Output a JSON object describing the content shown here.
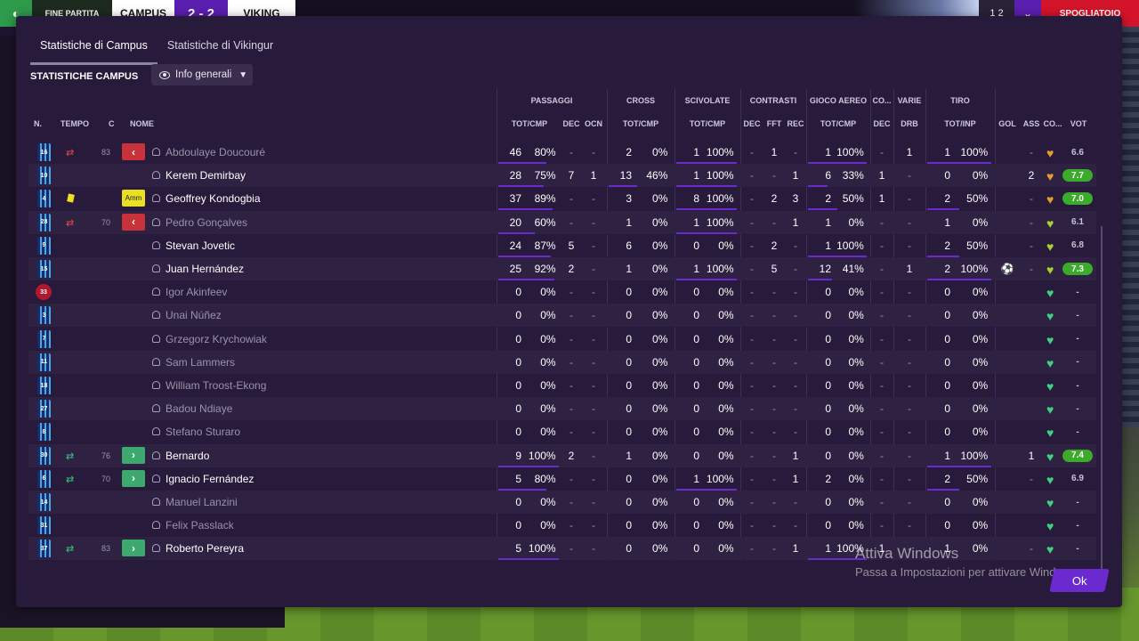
{
  "topbar": {
    "status": "FINE PARTITA",
    "home_team": "CAMPUS",
    "score": "2 - 2",
    "away_team": "VIKING",
    "right_count": "1 2",
    "right_label": "SPOGLIATOIO"
  },
  "tabs": [
    "Statistiche di Campus",
    "Statistiche di Vikingur"
  ],
  "section_title": "STATISTICHE CAMPUS",
  "view_select": "Info generali",
  "group_headers": [
    "PASSAGGI",
    "CROSS",
    "SCIVOLATE",
    "CONTRASTI",
    "GIOCO AEREO",
    "CO...",
    "VARIE",
    "TIRO"
  ],
  "column_headers": {
    "n": "N.",
    "tempo": "TEMPO",
    "c": "C",
    "nome": "NOME",
    "pass": "TOT/CMP",
    "dec": "DEC",
    "ocn": "OCN",
    "cross": "TOT/CMP",
    "sciv": "TOT/CMP",
    "cdec": "DEC",
    "fft": "FFT",
    "rec": "REC",
    "aereo": "TOT/CMP",
    "codec": "DEC",
    "drb": "DRB",
    "tiro": "TOT/INP",
    "gol": "GOL",
    "ass": "ASS",
    "co": "CO...",
    "vot": "VOT"
  },
  "players": [
    {
      "num": "16",
      "sub": "out",
      "min": "83",
      "badge": "out",
      "name": "Abdoulaye Doucouré",
      "dim": true,
      "p_tot": "46",
      "p_pct": "80%",
      "p_bar": 80,
      "dec": "-",
      "ocn": "-",
      "c_tot": "2",
      "c_pct": "0%",
      "s_tot": "1",
      "s_pct": "100%",
      "cdec": "-",
      "fft": "1",
      "rec": "-",
      "a_tot": "1",
      "a_pct": "100%",
      "codec": "-",
      "drb": "1",
      "t_tot": "1",
      "t_pct": "100%",
      "gol": "",
      "ass": "-",
      "heart": "#e0a030",
      "vote": "6.6",
      "vote_hi": false
    },
    {
      "num": "10",
      "sub": "",
      "min": "",
      "badge": "",
      "name": "Kerem Demirbay",
      "dim": false,
      "p_tot": "28",
      "p_pct": "75%",
      "p_bar": 75,
      "dec": "7",
      "ocn": "1",
      "c_tot": "13",
      "c_pct": "46%",
      "s_tot": "1",
      "s_pct": "100%",
      "cdec": "-",
      "fft": "-",
      "rec": "1",
      "a_tot": "6",
      "a_pct": "33%",
      "codec": "1",
      "drb": "-",
      "t_tot": "0",
      "t_pct": "0%",
      "gol": "",
      "ass": "2",
      "heart": "#e0a030",
      "vote": "7.7",
      "vote_hi": true
    },
    {
      "num": "4",
      "sub": "",
      "min": "",
      "badge": "amm",
      "yellow": true,
      "name": "Geoffrey Kondogbia",
      "dim": false,
      "p_tot": "37",
      "p_pct": "89%",
      "p_bar": 89,
      "dec": "-",
      "ocn": "-",
      "c_tot": "3",
      "c_pct": "0%",
      "s_tot": "8",
      "s_pct": "100%",
      "cdec": "-",
      "fft": "2",
      "rec": "3",
      "a_tot": "2",
      "a_pct": "50%",
      "codec": "1",
      "drb": "-",
      "t_tot": "2",
      "t_pct": "50%",
      "gol": "",
      "ass": "-",
      "heart": "#e0a030",
      "vote": "7.0",
      "vote_hi": true
    },
    {
      "num": "28",
      "sub": "out",
      "min": "70",
      "badge": "out",
      "name": "Pedro Gonçalves",
      "dim": true,
      "p_tot": "20",
      "p_pct": "60%",
      "p_bar": 60,
      "dec": "-",
      "ocn": "-",
      "c_tot": "1",
      "c_pct": "0%",
      "s_tot": "1",
      "s_pct": "100%",
      "cdec": "-",
      "fft": "-",
      "rec": "1",
      "a_tot": "1",
      "a_pct": "0%",
      "codec": "-",
      "drb": "-",
      "t_tot": "1",
      "t_pct": "0%",
      "gol": "",
      "ass": "-",
      "heart": "#a8d030",
      "vote": "6.1",
      "vote_hi": false
    },
    {
      "num": "9",
      "sub": "",
      "min": "",
      "badge": "",
      "name": "Stevan Jovetic",
      "dim": false,
      "p_tot": "24",
      "p_pct": "87%",
      "p_bar": 87,
      "dec": "5",
      "ocn": "-",
      "c_tot": "6",
      "c_pct": "0%",
      "s_tot": "0",
      "s_pct": "0%",
      "cdec": "-",
      "fft": "2",
      "rec": "-",
      "a_tot": "1",
      "a_pct": "100%",
      "codec": "-",
      "drb": "-",
      "t_tot": "2",
      "t_pct": "50%",
      "gol": "",
      "ass": "-",
      "heart": "#a8d030",
      "vote": "6.8",
      "vote_hi": false
    },
    {
      "num": "15",
      "sub": "",
      "min": "",
      "badge": "",
      "name": "Juan Hernández",
      "dim": false,
      "p_tot": "25",
      "p_pct": "92%",
      "p_bar": 92,
      "dec": "2",
      "ocn": "-",
      "c_tot": "1",
      "c_pct": "0%",
      "s_tot": "1",
      "s_pct": "100%",
      "cdec": "-",
      "fft": "5",
      "rec": "-",
      "a_tot": "12",
      "a_pct": "41%",
      "codec": "-",
      "drb": "1",
      "t_tot": "2",
      "t_pct": "100%",
      "gol": "⚽",
      "ass": "-",
      "heart": "#a8d030",
      "vote": "7.3",
      "vote_hi": true
    },
    {
      "num": "33",
      "gk": true,
      "sub": "",
      "min": "",
      "badge": "",
      "name": "Igor Akinfeev",
      "dim": true,
      "p_tot": "0",
      "p_pct": "0%",
      "p_bar": 0,
      "dec": "-",
      "ocn": "-",
      "c_tot": "0",
      "c_pct": "0%",
      "s_tot": "0",
      "s_pct": "0%",
      "cdec": "-",
      "fft": "-",
      "rec": "-",
      "a_tot": "0",
      "a_pct": "0%",
      "codec": "-",
      "drb": "-",
      "t_tot": "0",
      "t_pct": "0%",
      "gol": "",
      "ass": "",
      "heart": "#3fd080",
      "vote": "-",
      "vote_hi": false
    },
    {
      "num": "3",
      "sub": "",
      "min": "",
      "badge": "",
      "name": "Unai Núñez",
      "dim": true,
      "p_tot": "0",
      "p_pct": "0%",
      "p_bar": 0,
      "dec": "-",
      "ocn": "-",
      "c_tot": "0",
      "c_pct": "0%",
      "s_tot": "0",
      "s_pct": "0%",
      "cdec": "-",
      "fft": "-",
      "rec": "-",
      "a_tot": "0",
      "a_pct": "0%",
      "codec": "-",
      "drb": "-",
      "t_tot": "0",
      "t_pct": "0%",
      "gol": "",
      "ass": "",
      "heart": "#3fd080",
      "vote": "-",
      "vote_hi": false
    },
    {
      "num": "7",
      "sub": "",
      "min": "",
      "badge": "",
      "name": "Grzegorz Krychowiak",
      "dim": true,
      "p_tot": "0",
      "p_pct": "0%",
      "p_bar": 0,
      "dec": "-",
      "ocn": "-",
      "c_tot": "0",
      "c_pct": "0%",
      "s_tot": "0",
      "s_pct": "0%",
      "cdec": "-",
      "fft": "-",
      "rec": "-",
      "a_tot": "0",
      "a_pct": "0%",
      "codec": "-",
      "drb": "-",
      "t_tot": "0",
      "t_pct": "0%",
      "gol": "",
      "ass": "",
      "heart": "#3fd080",
      "vote": "-",
      "vote_hi": false
    },
    {
      "num": "11",
      "sub": "",
      "min": "",
      "badge": "",
      "name": "Sam Lammers",
      "dim": true,
      "p_tot": "0",
      "p_pct": "0%",
      "p_bar": 0,
      "dec": "-",
      "ocn": "-",
      "c_tot": "0",
      "c_pct": "0%",
      "s_tot": "0",
      "s_pct": "0%",
      "cdec": "-",
      "fft": "-",
      "rec": "-",
      "a_tot": "0",
      "a_pct": "0%",
      "codec": "-",
      "drb": "-",
      "t_tot": "0",
      "t_pct": "0%",
      "gol": "",
      "ass": "",
      "heart": "#3fd080",
      "vote": "-",
      "vote_hi": false
    },
    {
      "num": "18",
      "sub": "",
      "min": "",
      "badge": "",
      "name": "William Troost-Ekong",
      "dim": true,
      "p_tot": "0",
      "p_pct": "0%",
      "p_bar": 0,
      "dec": "-",
      "ocn": "-",
      "c_tot": "0",
      "c_pct": "0%",
      "s_tot": "0",
      "s_pct": "0%",
      "cdec": "-",
      "fft": "-",
      "rec": "-",
      "a_tot": "0",
      "a_pct": "0%",
      "codec": "-",
      "drb": "-",
      "t_tot": "0",
      "t_pct": "0%",
      "gol": "",
      "ass": "",
      "heart": "#3fd080",
      "vote": "-",
      "vote_hi": false
    },
    {
      "num": "27",
      "sub": "",
      "min": "",
      "badge": "",
      "name": "Badou Ndiaye",
      "dim": true,
      "p_tot": "0",
      "p_pct": "0%",
      "p_bar": 0,
      "dec": "-",
      "ocn": "-",
      "c_tot": "0",
      "c_pct": "0%",
      "s_tot": "0",
      "s_pct": "0%",
      "cdec": "-",
      "fft": "-",
      "rec": "-",
      "a_tot": "0",
      "a_pct": "0%",
      "codec": "-",
      "drb": "-",
      "t_tot": "0",
      "t_pct": "0%",
      "gol": "",
      "ass": "",
      "heart": "#3fd080",
      "vote": "-",
      "vote_hi": false
    },
    {
      "num": "8",
      "sub": "",
      "min": "",
      "badge": "",
      "name": "Stefano Sturaro",
      "dim": true,
      "p_tot": "0",
      "p_pct": "0%",
      "p_bar": 0,
      "dec": "-",
      "ocn": "-",
      "c_tot": "0",
      "c_pct": "0%",
      "s_tot": "0",
      "s_pct": "0%",
      "cdec": "-",
      "fft": "-",
      "rec": "-",
      "a_tot": "0",
      "a_pct": "0%",
      "codec": "-",
      "drb": "-",
      "t_tot": "0",
      "t_pct": "0%",
      "gol": "",
      "ass": "",
      "heart": "#3fd080",
      "vote": "-",
      "vote_hi": false
    },
    {
      "num": "30",
      "sub": "in",
      "min": "76",
      "badge": "in",
      "name": "Bernardo",
      "dim": false,
      "p_tot": "9",
      "p_pct": "100%",
      "p_bar": 100,
      "dec": "2",
      "ocn": "-",
      "c_tot": "1",
      "c_pct": "0%",
      "s_tot": "0",
      "s_pct": "0%",
      "cdec": "-",
      "fft": "-",
      "rec": "1",
      "a_tot": "0",
      "a_pct": "0%",
      "codec": "-",
      "drb": "-",
      "t_tot": "1",
      "t_pct": "100%",
      "gol": "",
      "ass": "1",
      "heart": "#3fd080",
      "vote": "7.4",
      "vote_hi": true
    },
    {
      "num": "6",
      "sub": "in",
      "min": "70",
      "badge": "in",
      "name": "Ignacio Fernández",
      "dim": false,
      "p_tot": "5",
      "p_pct": "80%",
      "p_bar": 80,
      "dec": "-",
      "ocn": "-",
      "c_tot": "0",
      "c_pct": "0%",
      "s_tot": "1",
      "s_pct": "100%",
      "cdec": "-",
      "fft": "-",
      "rec": "1",
      "a_tot": "2",
      "a_pct": "0%",
      "codec": "-",
      "drb": "-",
      "t_tot": "2",
      "t_pct": "50%",
      "gol": "",
      "ass": "-",
      "heart": "#3fd080",
      "vote": "6.9",
      "vote_hi": false
    },
    {
      "num": "14",
      "sub": "",
      "min": "",
      "badge": "",
      "name": "Manuel Lanzini",
      "dim": true,
      "p_tot": "0",
      "p_pct": "0%",
      "p_bar": 0,
      "dec": "-",
      "ocn": "-",
      "c_tot": "0",
      "c_pct": "0%",
      "s_tot": "0",
      "s_pct": "0%",
      "cdec": "-",
      "fft": "-",
      "rec": "-",
      "a_tot": "0",
      "a_pct": "0%",
      "codec": "-",
      "drb": "-",
      "t_tot": "0",
      "t_pct": "0%",
      "gol": "",
      "ass": "",
      "heart": "#3fd080",
      "vote": "-",
      "vote_hi": false
    },
    {
      "num": "31",
      "sub": "",
      "min": "",
      "badge": "",
      "name": "Felix Passlack",
      "dim": true,
      "p_tot": "0",
      "p_pct": "0%",
      "p_bar": 0,
      "dec": "-",
      "ocn": "-",
      "c_tot": "0",
      "c_pct": "0%",
      "s_tot": "0",
      "s_pct": "0%",
      "cdec": "-",
      "fft": "-",
      "rec": "-",
      "a_tot": "0",
      "a_pct": "0%",
      "codec": "-",
      "drb": "-",
      "t_tot": "0",
      "t_pct": "0%",
      "gol": "",
      "ass": "",
      "heart": "#3fd080",
      "vote": "-",
      "vote_hi": false
    },
    {
      "num": "37",
      "sub": "in",
      "min": "83",
      "badge": "in",
      "name": "Roberto Pereyra",
      "dim": false,
      "p_tot": "5",
      "p_pct": "100%",
      "p_bar": 100,
      "dec": "-",
      "ocn": "-",
      "c_tot": "0",
      "c_pct": "0%",
      "s_tot": "0",
      "s_pct": "0%",
      "cdec": "-",
      "fft": "-",
      "rec": "1",
      "a_tot": "1",
      "a_pct": "100%",
      "codec": "1",
      "drb": "-",
      "t_tot": "1",
      "t_pct": "0%",
      "gol": "",
      "ass": "-",
      "heart": "#3fd080",
      "vote": "-",
      "vote_hi": false
    }
  ],
  "badge_labels": {
    "amm": "Amm"
  },
  "watermark": {
    "line1": "Attiva Windows",
    "line2": "Passa a Impostazioni per attivare Windows."
  },
  "ok_label": "Ok"
}
